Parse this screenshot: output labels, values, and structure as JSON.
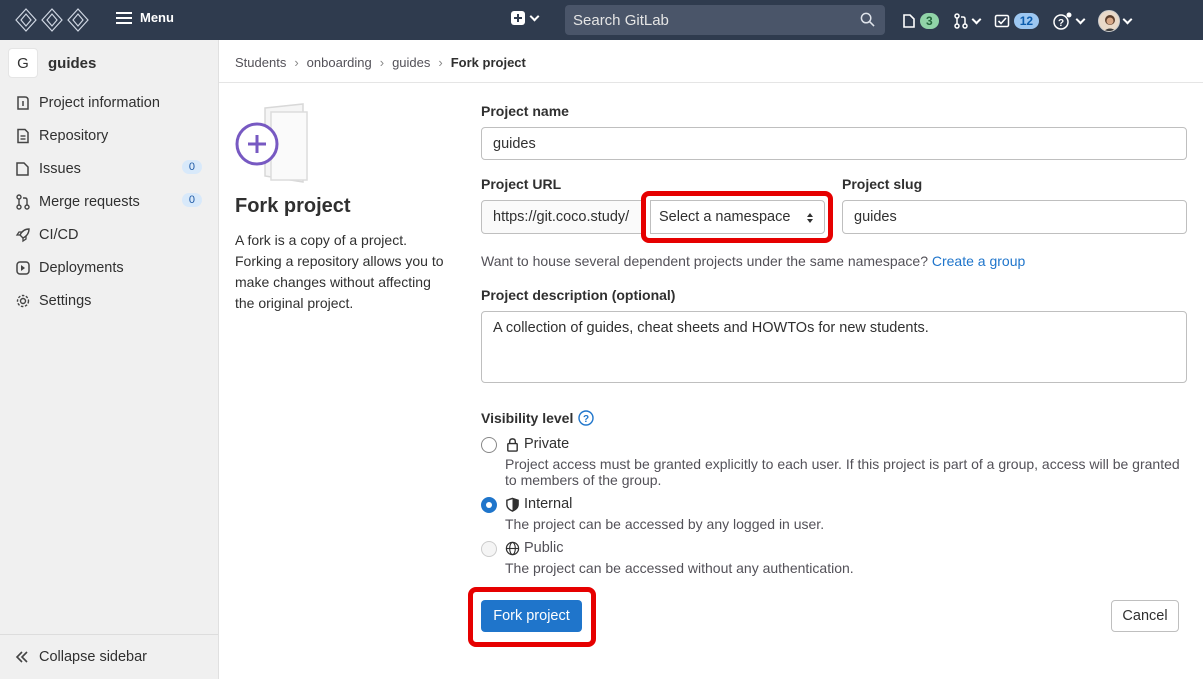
{
  "topbar": {
    "menu_label": "Menu",
    "search_placeholder": "Search GitLab",
    "issues_count": "3",
    "todos_count": "12"
  },
  "sidebar": {
    "project_initial": "G",
    "project_name": "guides",
    "items": [
      {
        "label": "Project information",
        "icon": "info-icon"
      },
      {
        "label": "Repository",
        "icon": "doc-icon"
      },
      {
        "label": "Issues",
        "icon": "issues-icon",
        "count": "0"
      },
      {
        "label": "Merge requests",
        "icon": "merge-request-icon",
        "count": "0"
      },
      {
        "label": "CI/CD",
        "icon": "rocket-icon"
      },
      {
        "label": "Deployments",
        "icon": "deployments-icon"
      },
      {
        "label": "Settings",
        "icon": "gear-icon"
      }
    ],
    "collapse_label": "Collapse sidebar"
  },
  "breadcrumb": [
    "Students",
    "onboarding",
    "guides",
    "Fork project"
  ],
  "info": {
    "title": "Fork project",
    "description": "A fork is a copy of a project. Forking a repository allows you to make changes without affecting the original project."
  },
  "form": {
    "project_name_label": "Project name",
    "project_name_value": "guides",
    "project_url_label": "Project URL",
    "url_prefix": "https://git.coco.study/",
    "namespace_placeholder": "Select a namespace",
    "slug_label": "Project slug",
    "slug_value": "guides",
    "namespace_help": "Want to house several dependent projects under the same namespace?",
    "create_group_link": "Create a group",
    "description_label": "Project description (optional)",
    "description_value": "A collection of guides, cheat sheets and HOWTOs for new students.",
    "visibility_label": "Visibility level",
    "visibility": [
      {
        "label": "Private",
        "icon": "lock-icon",
        "description": "Project access must be granted explicitly to each user. If this project is part of a group, access will be granted to members of the group.",
        "checked": false,
        "disabled": false
      },
      {
        "label": "Internal",
        "icon": "shield-icon",
        "description": "The project can be accessed by any logged in user.",
        "checked": true,
        "disabled": false
      },
      {
        "label": "Public",
        "icon": "globe-icon",
        "description": "The project can be accessed without any authentication.",
        "checked": false,
        "disabled": true
      }
    ],
    "submit_label": "Fork project",
    "cancel_label": "Cancel"
  },
  "colors": {
    "topbar": "#2f3b4e",
    "primary": "#1f75cb",
    "highlight": "#e60000"
  }
}
